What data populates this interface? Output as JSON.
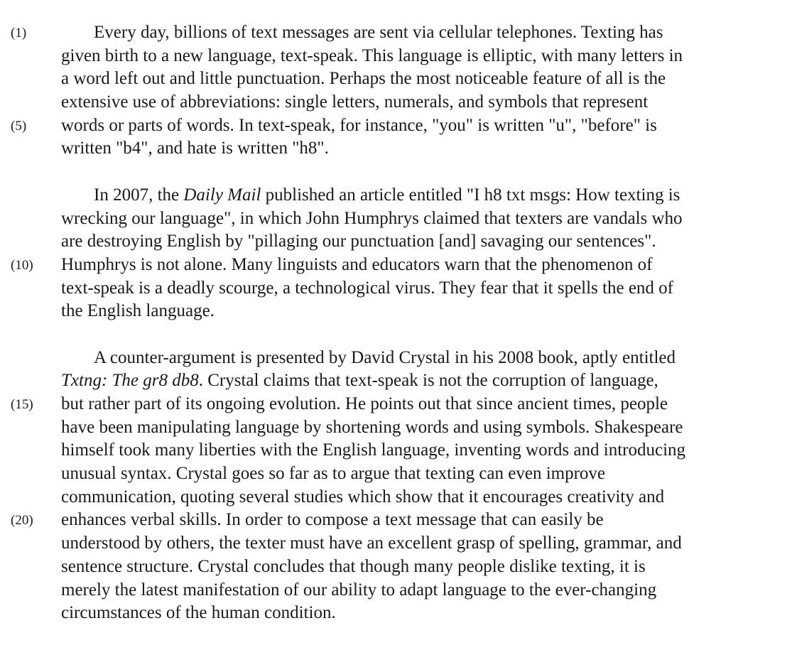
{
  "passage": {
    "paragraphs": [
      {
        "lines": [
          {
            "num": "(1)",
            "text": "Every day, billions of text messages are sent via cellular telephones.  Texting has"
          },
          {
            "num": "",
            "text": "given birth to a new language, text-speak.  This language is elliptic, with many letters in"
          },
          {
            "num": "",
            "text": "a word left out and little punctuation.  Perhaps the most noticeable feature of all is the"
          },
          {
            "num": "",
            "text": "extensive use of abbreviations:  single letters, numerals, and symbols that represent"
          },
          {
            "num": "(5)",
            "text": "words or parts of words.  In text-speak, for instance, \"you\" is written \"u\", \"before\" is"
          },
          {
            "num": "",
            "text": "written \"b4\", and hate is written \"h8\"."
          }
        ]
      },
      {
        "lines": [
          {
            "num": "",
            "text_pre": "In 2007, the ",
            "text_em": "Daily Mail",
            "text_post": " published an article entitled \"I h8 txt msgs:  How texting is"
          },
          {
            "num": "",
            "text": "wrecking our language\", in which John Humphrys claimed that texters are vandals who"
          },
          {
            "num": "",
            "text": "are destroying English by \"pillaging our punctuation [and] savaging our sentences\"."
          },
          {
            "num": "(10)",
            "text": "Humphrys is not alone.  Many linguists and educators warn that the phenomenon of"
          },
          {
            "num": "",
            "text": "text-speak is a deadly scourge, a technological virus.  They fear that it spells the end of"
          },
          {
            "num": "",
            "text": "the English language."
          }
        ]
      },
      {
        "lines": [
          {
            "num": "",
            "text": "A counter-argument is presented by David Crystal in his 2008 book, aptly entitled"
          },
          {
            "num": "",
            "text_em": "Txtng:  The gr8 db8",
            "text_post": ".  Crystal claims that text-speak is not the corruption of language,"
          },
          {
            "num": "(15)",
            "text": "but rather part of its ongoing evolution.  He points out that since ancient times, people"
          },
          {
            "num": "",
            "text": "have been manipulating language by shortening words and using symbols.  Shakespeare"
          },
          {
            "num": "",
            "text": "himself took many liberties with the English language, inventing words and introducing"
          },
          {
            "num": "",
            "text": "unusual syntax.  Crystal goes so far as to argue that texting can even improve"
          },
          {
            "num": "",
            "text": "communication, quoting several studies which show that it encourages creativity and"
          },
          {
            "num": "(20)",
            "text": "enhances verbal skills.  In order to compose a text message that can easily be"
          },
          {
            "num": "",
            "text": "understood by others, the texter must have an excellent grasp of spelling, grammar, and"
          },
          {
            "num": "",
            "text": "sentence structure.  Crystal concludes that though many people dislike texting, it is"
          },
          {
            "num": "",
            "text": "merely the latest manifestation of our ability to adapt language to the ever-changing"
          },
          {
            "num": "",
            "text": "circumstances of the human condition."
          }
        ]
      }
    ]
  }
}
